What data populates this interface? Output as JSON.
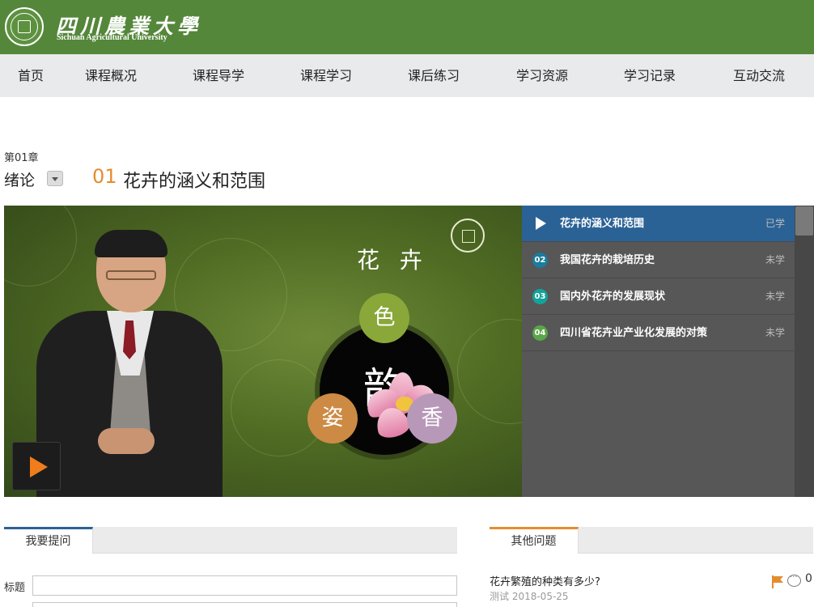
{
  "header": {
    "logo_cn": "四川農業大學",
    "logo_en": "Sichuan Agricultural University"
  },
  "nav": {
    "items": [
      "首页",
      "课程概况",
      "课程导学",
      "课程学习",
      "课后练习",
      "学习资源",
      "学习记录",
      "互动交流"
    ]
  },
  "chapter": {
    "number": "第01章",
    "title": "绪论"
  },
  "lesson": {
    "number": "01",
    "title": "花卉的涵义和范围"
  },
  "video": {
    "slide_title": "花 卉",
    "center_char": "韵",
    "bubbles": [
      "色",
      "姿",
      "香"
    ],
    "colors": {
      "se": "#8aa73a",
      "zi": "#cc8a44",
      "xiang": "#b898b8",
      "play_accent": "#f07c1b"
    }
  },
  "playlist": {
    "items": [
      {
        "num": "",
        "title": "花卉的涵义和范围",
        "status": "已学",
        "badge_color": ""
      },
      {
        "num": "02",
        "title": "我国花卉的栽培历史",
        "status": "未学",
        "badge_color": "#1b7c9c"
      },
      {
        "num": "03",
        "title": "国内外花卉的发展现状",
        "status": "未学",
        "badge_color": "#13a39a"
      },
      {
        "num": "04",
        "title": "四川省花卉业产业化发展的对策",
        "status": "未学",
        "badge_color": "#5aa64a"
      }
    ],
    "active_color": "#2b6296"
  },
  "ask": {
    "tab": "我要提问",
    "title_label": "标题",
    "title_value": ""
  },
  "others": {
    "tab": "其他问题",
    "question": "花卉繁殖的种类有多少?",
    "meta": "测试 2018-05-25",
    "count": "0"
  },
  "theme": {
    "header_green": "#54873a",
    "accent_orange": "#e48c2e"
  }
}
